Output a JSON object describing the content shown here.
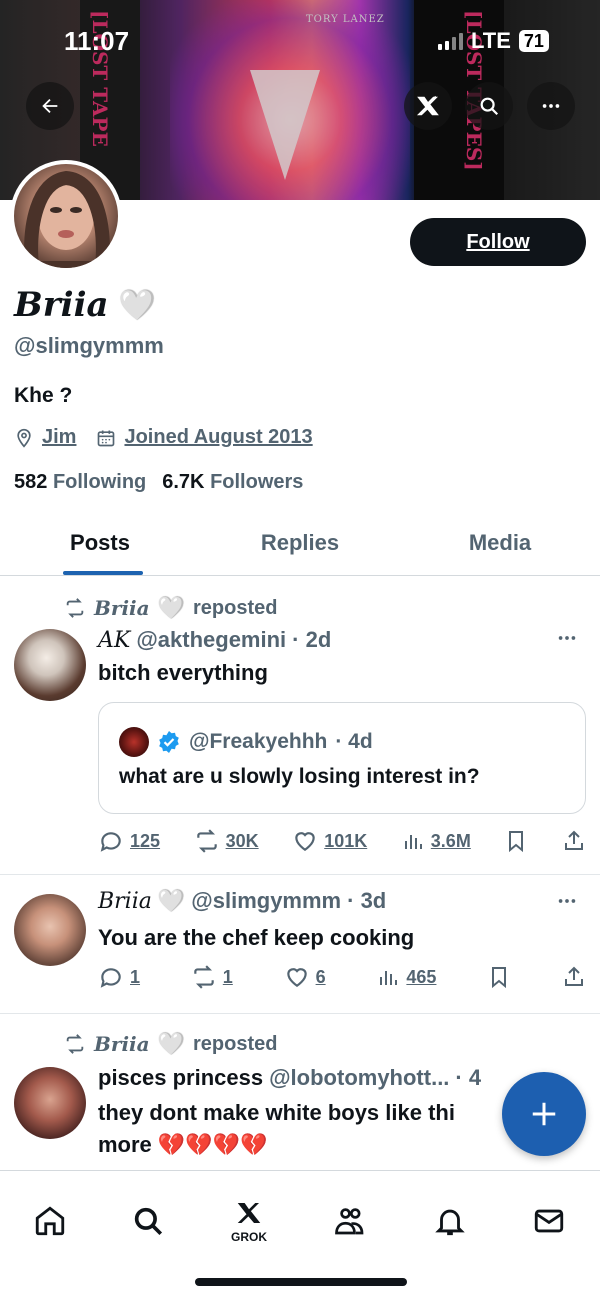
{
  "status_bar": {
    "time": "11:07",
    "network": "LTE",
    "battery": "71"
  },
  "banner": {
    "text_left": "[LOST TAPE",
    "text_right": "[LOST TAPES]",
    "text_top": "TORY LANEZ"
  },
  "header": {
    "follow_label": "Follow"
  },
  "profile": {
    "display_name": "Briia",
    "heart": "🤍",
    "handle": "@slimgymmm",
    "bio": "Khe ?",
    "location": "Jim",
    "joined": "Joined August 2013",
    "following_count": "582",
    "following_label": "Following",
    "followers_count": "6.7K",
    "followers_label": "Followers"
  },
  "tabs": [
    {
      "label": "Posts",
      "active": true
    },
    {
      "label": "Replies",
      "active": false
    },
    {
      "label": "Media",
      "active": false
    }
  ],
  "posts": [
    {
      "repost_by": "Briia",
      "repost_heart": "🤍",
      "repost_label": "reposted",
      "author": "AK",
      "handle": "@akthegemini",
      "time": "· 2d",
      "text": "bitch everything",
      "quote": {
        "handle": "@Freakyehhh",
        "time": "· 4d",
        "text": "what are u slowly losing interest in?"
      },
      "replies": "125",
      "reposts": "30K",
      "likes": "101K",
      "views": "3.6M"
    },
    {
      "author": "Briia",
      "author_heart": "🤍",
      "handle": "@slimgymmm",
      "time": "· 3d",
      "text": "You are the chef keep cooking",
      "replies": "1",
      "reposts": "1",
      "likes": "6",
      "views": "465"
    },
    {
      "repost_by": "Briia",
      "repost_heart": "🤍",
      "repost_label": "reposted",
      "author": "pisces princess",
      "handle": "@lobotomyhott...",
      "time": "· 4",
      "text_line1": "they dont make white boys like thi",
      "text_line2": "more 💔💔💔💔"
    }
  ],
  "bottom_nav": {
    "grok_label": "GROK"
  },
  "colors": {
    "accent": "#1d5fb0",
    "text": "#0f1419",
    "secondary": "#536471",
    "verified": "#1d9bf0"
  }
}
